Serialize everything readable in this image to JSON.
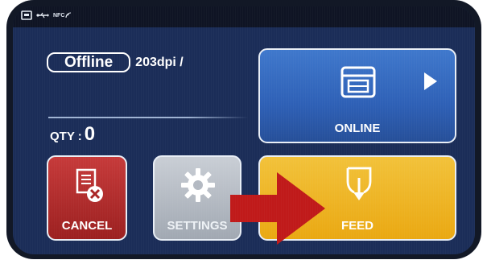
{
  "status_bar": {
    "icons": [
      "sd-card-icon",
      "usb-icon",
      "nfc-icon"
    ],
    "nfc_label": "NFC"
  },
  "status": {
    "state": "Offline",
    "resolution": "203dpi /"
  },
  "quantity": {
    "label": "QTY :",
    "value": "0"
  },
  "tiles": {
    "online": {
      "label": "ONLINE",
      "icon": "printer-icon",
      "color": "#2e60b6"
    },
    "cancel": {
      "label": "CANCEL",
      "icon": "document-cancel-icon",
      "color": "#b02a2a"
    },
    "settings": {
      "label": "SETTINGS",
      "icon": "gear-icon",
      "color": "#b6bcc5"
    },
    "feed": {
      "label": "FEED",
      "icon": "paper-feed-icon",
      "color": "#f0b62a"
    }
  },
  "overlay": {
    "arrow_color": "#c01a1a"
  }
}
